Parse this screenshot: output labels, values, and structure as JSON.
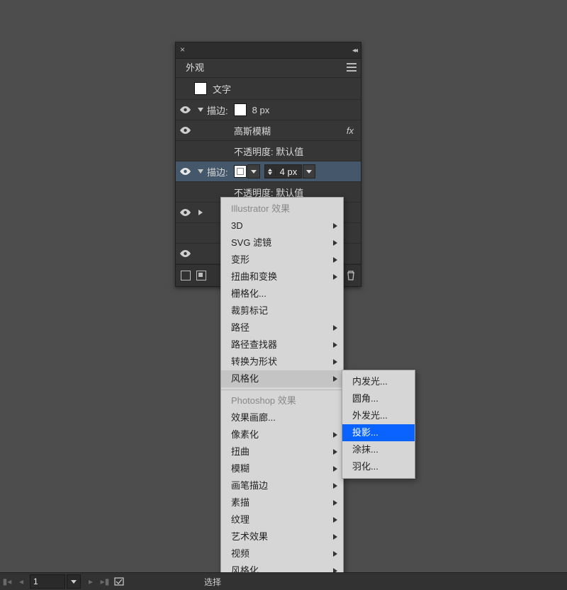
{
  "panel": {
    "title": "外观",
    "root_label": "文字",
    "rows": {
      "stroke1_label": "描边:",
      "stroke1_size": "8 px",
      "gauss": "高斯模糊",
      "opacity1": "不透明度: 默认值",
      "stroke2_label": "描边:",
      "stroke2_size": "4 px",
      "opacity2": "不透明度: 默认值"
    }
  },
  "menu": {
    "section1": "Illustrator 效果",
    "items1": [
      "3D",
      "SVG 滤镜",
      "变形",
      "扭曲和变换",
      "栅格化...",
      "裁剪标记",
      "路径",
      "路径查找器",
      "转换为形状",
      "风格化"
    ],
    "section2": "Photoshop 效果",
    "items2": [
      "效果画廊...",
      "像素化",
      "扭曲",
      "模糊",
      "画笔描边",
      "素描",
      "纹理",
      "艺术效果",
      "视频",
      "风格化"
    ],
    "sub": [
      "内发光...",
      "圆角...",
      "外发光...",
      "投影...",
      "涂抹...",
      "羽化..."
    ]
  },
  "bottom": {
    "page": "1",
    "mode": "选择"
  }
}
